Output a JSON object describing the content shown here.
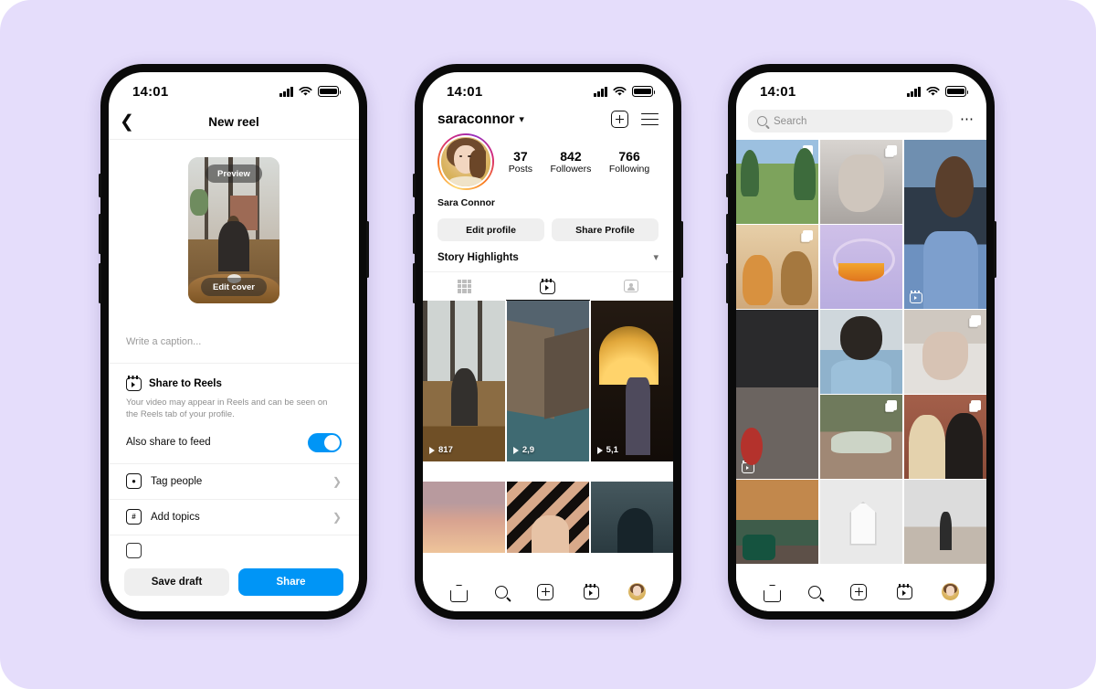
{
  "background_color": "#e5ddfb",
  "accent_color": "#0095f6",
  "status_bar": {
    "time": "14:01",
    "signal_icon": "signal-icon",
    "wifi_icon": "wifi-icon",
    "battery_icon": "battery-icon"
  },
  "phone1": {
    "nav": {
      "back_icon": "back-chevron-icon",
      "title": "New reel"
    },
    "cover": {
      "preview_label": "Preview",
      "edit_cover_label": "Edit cover"
    },
    "caption_placeholder": "Write a caption...",
    "share_to_reels": {
      "icon": "reels-icon",
      "title": "Share to Reels",
      "description": "Your video may appear in Reels and can be seen on the Reels tab of your profile.",
      "toggle_label": "Also share to feed",
      "toggle_on": true
    },
    "options": [
      {
        "icon": "tag-person-icon",
        "label": "Tag people",
        "chevron": "chevron-right-icon"
      },
      {
        "icon": "hashtag-icon",
        "label": "Add topics",
        "chevron": "chevron-right-icon"
      }
    ],
    "actions": {
      "save_draft_label": "Save draft",
      "share_label": "Share"
    }
  },
  "phone2": {
    "header": {
      "username": "saraconnor",
      "chevron": "chevron-down-icon",
      "add_icon": "plus-box-icon",
      "menu_icon": "hamburger-menu-icon"
    },
    "avatar": "profile-avatar",
    "stats": [
      {
        "num": "37",
        "cap": "Posts"
      },
      {
        "num": "842",
        "cap": "Followers"
      },
      {
        "num": "766",
        "cap": "Following"
      }
    ],
    "full_name": "Sara Connor",
    "buttons": {
      "edit_profile": "Edit profile",
      "share_profile": "Share Profile"
    },
    "story_highlights": {
      "label": "Story Highlights",
      "chevron": "chevron-down-icon"
    },
    "tabs": [
      {
        "name": "grid",
        "icon": "grid-icon",
        "active": false
      },
      {
        "name": "reels",
        "icon": "reels-icon",
        "active": true
      },
      {
        "name": "tagged",
        "icon": "tagged-icon",
        "active": false
      }
    ],
    "reels": [
      {
        "art": "art-cafe",
        "views": "817"
      },
      {
        "art": "art-mtn",
        "views": "2,9"
      },
      {
        "art": "art-umb",
        "views": "5,1"
      },
      {
        "art": "art-sky",
        "views": ""
      },
      {
        "art": "art-strp",
        "views": ""
      },
      {
        "art": "art-dark",
        "views": ""
      }
    ]
  },
  "phone3": {
    "search": {
      "icon": "search-icon",
      "placeholder": "Search",
      "more_icon": "more-dots-icon"
    },
    "tiles": [
      {
        "art": "e-garden",
        "multi": true,
        "reel": false,
        "tall": false
      },
      {
        "art": "e-hands",
        "multi": true,
        "reel": false,
        "tall": false
      },
      {
        "art": "e-curly",
        "multi": false,
        "reel": true,
        "tall": true
      },
      {
        "art": "e-dogs",
        "multi": true,
        "reel": false,
        "tall": false
      },
      {
        "art": "e-wheel",
        "multi": false,
        "reel": false,
        "tall": false
      },
      {
        "art": "e-gym",
        "multi": false,
        "reel": true,
        "tall": true
      },
      {
        "art": "e-pug",
        "multi": false,
        "reel": false,
        "tall": false
      },
      {
        "art": "e-tattoo",
        "multi": true,
        "reel": false,
        "tall": false
      },
      {
        "art": "e-car",
        "multi": true,
        "reel": false,
        "tall": false
      },
      {
        "art": "e-2dogs",
        "multi": true,
        "reel": false,
        "tall": false
      },
      {
        "art": "e-autumn",
        "multi": false,
        "reel": false,
        "tall": false
      },
      {
        "art": "e-house",
        "multi": false,
        "reel": false,
        "tall": false
      },
      {
        "art": "e-ceiling",
        "multi": false,
        "reel": false,
        "tall": false
      }
    ]
  },
  "bottom_nav": [
    {
      "name": "home",
      "icon": "home-icon"
    },
    {
      "name": "search",
      "icon": "search-icon"
    },
    {
      "name": "create",
      "icon": "plus-box-icon"
    },
    {
      "name": "reels",
      "icon": "reels-icon"
    },
    {
      "name": "profile",
      "icon": "avatar-icon"
    }
  ]
}
